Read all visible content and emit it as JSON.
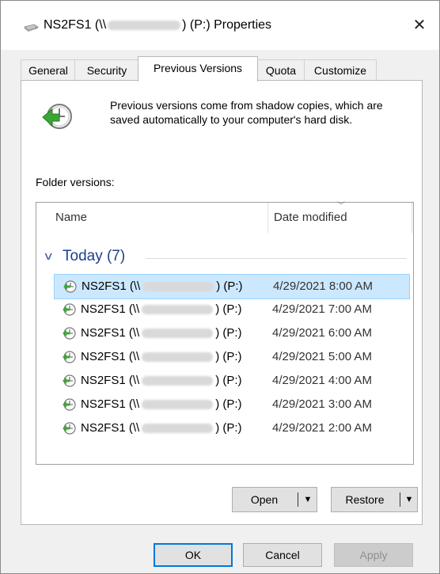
{
  "window": {
    "title_prefix": "NS2FS1 (\\\\",
    "title_suffix": ") (P:) Properties",
    "close_glyph": "✕"
  },
  "tabs": [
    {
      "label": "General",
      "active": false
    },
    {
      "label": "Security",
      "active": false
    },
    {
      "label": "Previous Versions",
      "active": true
    },
    {
      "label": "Quota",
      "active": false
    },
    {
      "label": "Customize",
      "active": false
    }
  ],
  "info": {
    "icon": "restore-clock-icon",
    "text": "Previous versions come from shadow copies, which are saved automatically to your computer's hard disk."
  },
  "folder_versions_label": "Folder versions:",
  "list": {
    "columns": {
      "name": "Name",
      "date": "Date modified"
    },
    "group": {
      "label": "Today (7)",
      "chevron": "∨"
    },
    "rows": [
      {
        "name_prefix": "NS2FS1 (\\\\",
        "name_suffix": ") (P:)",
        "date": "4/29/2021 8:00 AM",
        "selected": true
      },
      {
        "name_prefix": "NS2FS1 (\\\\",
        "name_suffix": ") (P:)",
        "date": "4/29/2021 7:00 AM",
        "selected": false
      },
      {
        "name_prefix": "NS2FS1 (\\\\",
        "name_suffix": ") (P:)",
        "date": "4/29/2021 6:00 AM",
        "selected": false
      },
      {
        "name_prefix": "NS2FS1 (\\\\",
        "name_suffix": ") (P:)",
        "date": "4/29/2021 5:00 AM",
        "selected": false
      },
      {
        "name_prefix": "NS2FS1 (\\\\",
        "name_suffix": ") (P:)",
        "date": "4/29/2021 4:00 AM",
        "selected": false
      },
      {
        "name_prefix": "NS2FS1 (\\\\",
        "name_suffix": ") (P:)",
        "date": "4/29/2021 3:00 AM",
        "selected": false
      },
      {
        "name_prefix": "NS2FS1 (\\\\",
        "name_suffix": ") (P:)",
        "date": "4/29/2021 2:00 AM",
        "selected": false
      }
    ]
  },
  "actions": {
    "open_label": "Open",
    "restore_label": "Restore",
    "dropdown_glyph": "▼"
  },
  "footer": {
    "ok_label": "OK",
    "cancel_label": "Cancel",
    "apply_label": "Apply"
  },
  "colors": {
    "selection_bg": "#cce8ff",
    "selection_border": "#99d1ff",
    "group_text": "#1e3f8a",
    "default_button_border": "#0078d7"
  }
}
